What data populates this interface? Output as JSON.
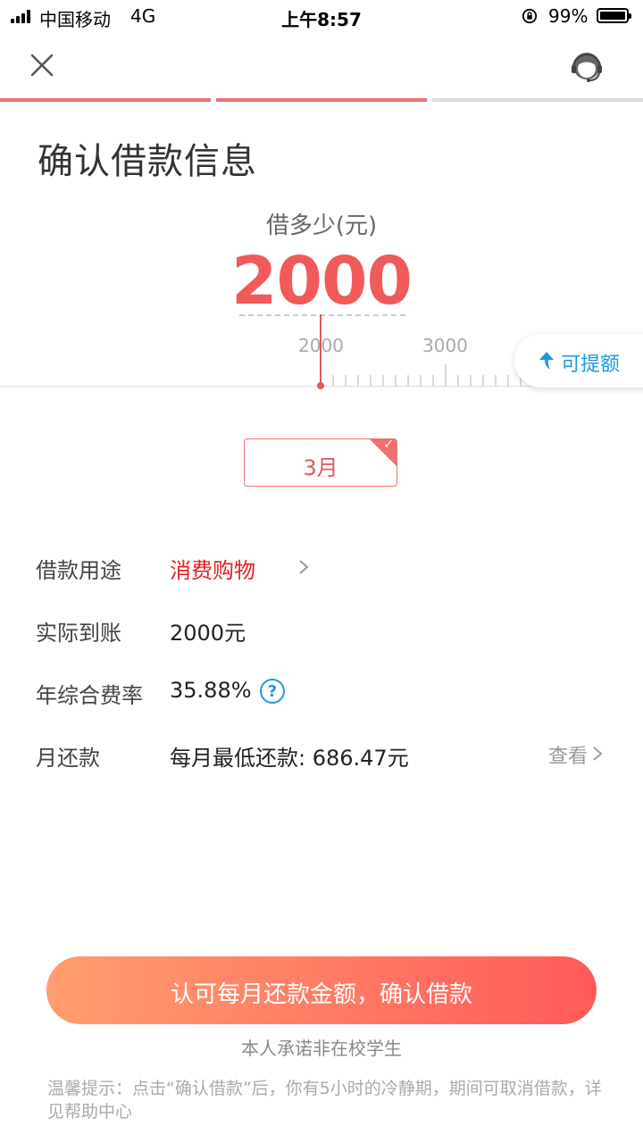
{
  "status_bar": {
    "carrier": "中国移动",
    "network": "4G",
    "time": "上午8:57",
    "battery": "99%"
  },
  "header": {
    "close_icon": "close-icon",
    "support_icon": "customer-service-icon"
  },
  "progress_steps": [
    {
      "state": "done",
      "color": "#f07070"
    },
    {
      "state": "done",
      "color": "#f07070"
    },
    {
      "state": "todo",
      "color": "#dddddd"
    }
  ],
  "title": "确认借款信息",
  "amount": {
    "label": "借多少(元)",
    "value": "2000",
    "scale_labels": [
      "2000",
      "3000"
    ]
  },
  "raise_limit": {
    "icon": "arrow-up-icon",
    "label": "可提额"
  },
  "term": {
    "selected": "3月"
  },
  "details": {
    "purpose_label": "借款用途",
    "purpose_value": "消费购物",
    "received_label": "实际到账",
    "received_value": "2000元",
    "rate_label": "年综合费率",
    "rate_value": "35.88%",
    "monthly_label": "月还款",
    "monthly_value": "每月最低还款: 686.47元",
    "view_label": "查看"
  },
  "confirm_button": "认可每月还款金额，确认借款",
  "pledge": "本人承诺非在校学生",
  "tip": "温馨提示：点击“确认借款”后，你有5小时的冷静期，期间可取消借款，详见帮助中心",
  "colors": {
    "accent": "#f05a5a",
    "link": "#1a9be0",
    "button_gradient_start": "#ff9e6e",
    "button_gradient_end": "#ff5a5a"
  }
}
